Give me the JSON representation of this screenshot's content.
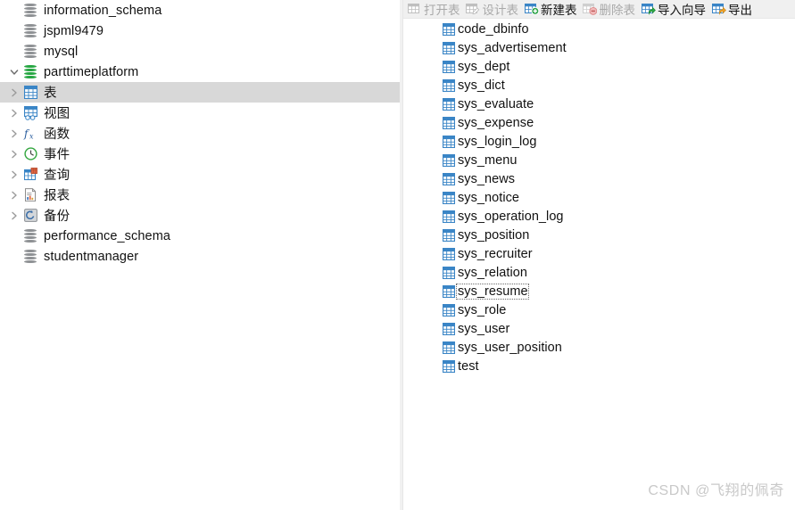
{
  "sidebar": {
    "tree": [
      {
        "label": "information_schema",
        "level": 0,
        "icon": "database-gray-icon",
        "twisty": "none",
        "selected": false
      },
      {
        "label": "jspml9479",
        "level": 0,
        "icon": "database-gray-icon",
        "twisty": "none",
        "selected": false
      },
      {
        "label": "mysql",
        "level": 0,
        "icon": "database-gray-icon",
        "twisty": "none",
        "selected": false
      },
      {
        "label": "parttimeplatform",
        "level": 0,
        "icon": "database-green-icon",
        "twisty": "expanded",
        "selected": false
      },
      {
        "label": "表",
        "level": 1,
        "icon": "table-icon",
        "twisty": "collapsed",
        "selected": true
      },
      {
        "label": "视图",
        "level": 1,
        "icon": "view-icon",
        "twisty": "collapsed",
        "selected": false
      },
      {
        "label": "函数",
        "level": 1,
        "icon": "function-icon",
        "twisty": "collapsed",
        "selected": false
      },
      {
        "label": "事件",
        "level": 1,
        "icon": "event-clock-icon",
        "twisty": "collapsed",
        "selected": false
      },
      {
        "label": "查询",
        "level": 1,
        "icon": "query-icon",
        "twisty": "collapsed",
        "selected": false
      },
      {
        "label": "报表",
        "level": 1,
        "icon": "report-icon",
        "twisty": "collapsed",
        "selected": false
      },
      {
        "label": "备份",
        "level": 1,
        "icon": "backup-icon",
        "twisty": "collapsed",
        "selected": false
      },
      {
        "label": "performance_schema",
        "level": 0,
        "icon": "database-gray-icon",
        "twisty": "none",
        "selected": false
      },
      {
        "label": "studentmanager",
        "level": 0,
        "icon": "database-gray-icon",
        "twisty": "none",
        "selected": false
      }
    ]
  },
  "toolbar": {
    "items": [
      {
        "label": "打开表",
        "icon": "open-table-icon",
        "enabled": false
      },
      {
        "label": "设计表",
        "icon": "design-table-icon",
        "enabled": false
      },
      {
        "label": "新建表",
        "icon": "new-table-icon",
        "enabled": true
      },
      {
        "label": "删除表",
        "icon": "delete-table-icon",
        "enabled": false
      },
      {
        "label": "导入向导",
        "icon": "import-wizard-icon",
        "enabled": true
      },
      {
        "label": "导出",
        "icon": "export-wizard-icon",
        "enabled": true
      }
    ]
  },
  "table_list": {
    "items": [
      {
        "name": "code_dbinfo",
        "focused": false
      },
      {
        "name": "sys_advertisement",
        "focused": false
      },
      {
        "name": "sys_dept",
        "focused": false
      },
      {
        "name": "sys_dict",
        "focused": false
      },
      {
        "name": "sys_evaluate",
        "focused": false
      },
      {
        "name": "sys_expense",
        "focused": false
      },
      {
        "name": "sys_login_log",
        "focused": false
      },
      {
        "name": "sys_menu",
        "focused": false
      },
      {
        "name": "sys_news",
        "focused": false
      },
      {
        "name": "sys_notice",
        "focused": false
      },
      {
        "name": "sys_operation_log",
        "focused": false
      },
      {
        "name": "sys_position",
        "focused": false
      },
      {
        "name": "sys_recruiter",
        "focused": false
      },
      {
        "name": "sys_relation",
        "focused": false
      },
      {
        "name": "sys_resume",
        "focused": true
      },
      {
        "name": "sys_role",
        "focused": false
      },
      {
        "name": "sys_user",
        "focused": false
      },
      {
        "name": "sys_user_position",
        "focused": false
      },
      {
        "name": "test",
        "focused": false
      }
    ]
  },
  "watermark": {
    "text": "CSDN @飞翔的佩奇"
  },
  "colors": {
    "selection": "#d8d8d8",
    "toolbar_bg": "#f0f0f0",
    "table_icon_blue": "#3a85c6",
    "db_green": "#27a743",
    "db_gray": "#8e9194",
    "disabled_text": "#a9a9a9",
    "watermark": "#c9c9c9"
  }
}
